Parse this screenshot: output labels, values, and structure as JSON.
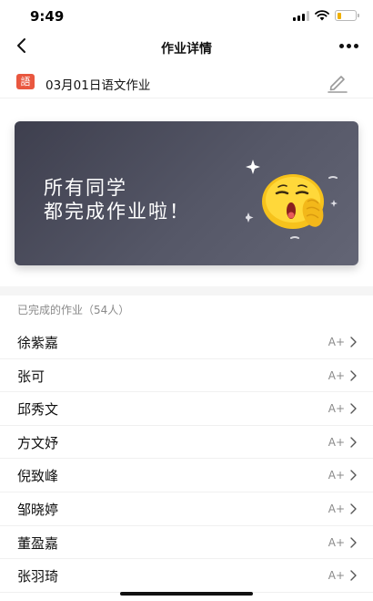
{
  "status_bar": {
    "time": "9:49",
    "battery_color": "#f0b000"
  },
  "nav": {
    "title": "作业详情",
    "back_icon": "chevron-left-icon",
    "more_icon": "more-horizontal-icon"
  },
  "assignment": {
    "subject_badge": "語",
    "title": "03月01日语文作业",
    "badge_color": "#e9573f",
    "edit_icon": "pencil-icon"
  },
  "banner": {
    "line1": "所有同学",
    "line2": "都完成作业啦！",
    "emoji_icon": "clapping-emoji-icon"
  },
  "completed_section": {
    "header": "已完成的作业（54人）",
    "students": [
      {
        "name": "徐紫嘉",
        "grade": "A+"
      },
      {
        "name": "张可",
        "grade": "A+"
      },
      {
        "name": "邱秀文",
        "grade": "A+"
      },
      {
        "name": "方文妤",
        "grade": "A+"
      },
      {
        "name": "倪致峰",
        "grade": "A+"
      },
      {
        "name": "邹晓婷",
        "grade": "A+"
      },
      {
        "name": "董盈嘉",
        "grade": "A+"
      },
      {
        "name": "张羽琦",
        "grade": "A+"
      }
    ]
  }
}
